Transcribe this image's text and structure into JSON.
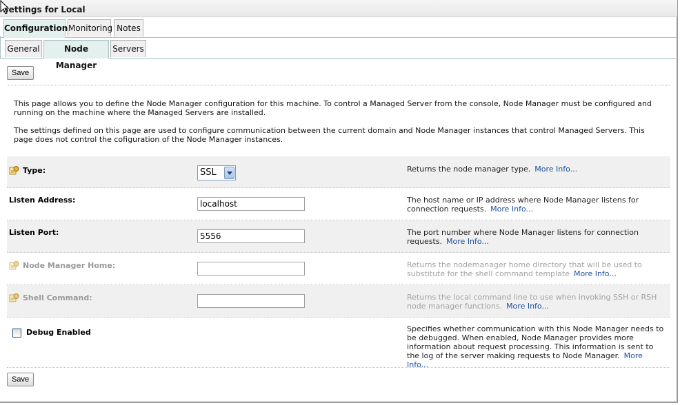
{
  "page": {
    "title": "Settings for Local"
  },
  "tabs": {
    "primary": [
      "Configuration",
      "Monitoring",
      "Notes"
    ],
    "primary_active": "Configuration",
    "secondary": [
      "General",
      "Node Manager",
      "Servers"
    ],
    "secondary_active": "Node Manager"
  },
  "toolbar": {
    "save_label": "Save"
  },
  "intro": {
    "p1": "This page allows you to define the Node Manager configuration for this machine. To control a Managed Server from the console, Node Manager must be configured and running on the machine where the Managed Servers are installed.",
    "p2": "The settings defined on this page are used to configure communication between the current domain and Node Manager instances that control Managed Servers. This page does not control the cofiguration of the Node Manager instances."
  },
  "fields": {
    "type": {
      "label": "Type:",
      "value": "SSL",
      "desc": "Returns the node manager type.",
      "more": "More Info..."
    },
    "listen_address": {
      "label": "Listen Address:",
      "value": "localhost",
      "desc": "The host name or IP address where Node Manager listens for connection requests.",
      "more": "More Info..."
    },
    "listen_port": {
      "label": "Listen Port:",
      "value": "5556",
      "desc": "The port number where Node Manager listens for connection requests.",
      "more": "More Info..."
    },
    "nm_home": {
      "label": "Node Manager Home:",
      "value": "",
      "desc": "Returns the nodemanager home directory that will be used to substitute for the shell command template",
      "more": "More Info..."
    },
    "shell_command": {
      "label": "Shell Command:",
      "value": "",
      "desc": "Returns the local command line to use when invoking SSH or RSH node manager functions.",
      "more": "More Info..."
    },
    "debug": {
      "label": "Debug Enabled",
      "checked": false,
      "desc": "Specifies whether communication with this Node Manager needs to be debugged. When enabled, Node Manager provides more information about request processing. This information is sent to the log of the server making requests to Node Manager.",
      "more": "More Info..."
    }
  },
  "colors": {
    "link": "#1f4e9c",
    "active_tab": "#e4f0ee",
    "shaded_row": "#f0f0f0",
    "disabled_text": "#9a9a9a"
  }
}
